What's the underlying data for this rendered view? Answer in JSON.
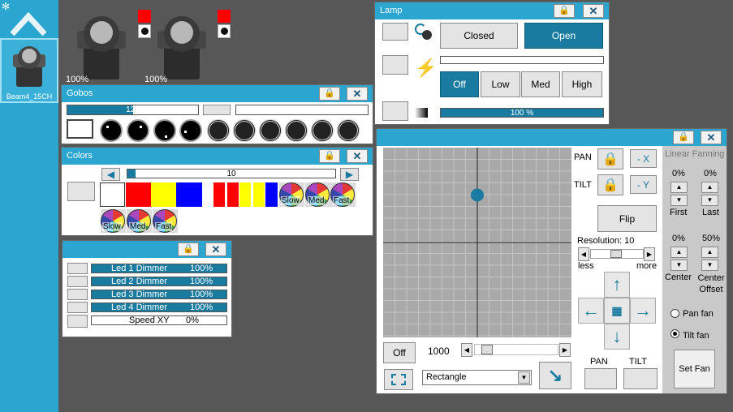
{
  "sidebar": {
    "fixture_label": "Beam4_15CH"
  },
  "fixtures": {
    "fixture1_value": "100%",
    "fixture2_value": "100%"
  },
  "gobos": {
    "title": "Gobos",
    "value": "129"
  },
  "colors": {
    "title": "Colors",
    "value": "10",
    "wheel_labels": [
      "Slow",
      "Med",
      "Fast",
      "Slow",
      "Med",
      "Fast"
    ]
  },
  "leds": {
    "items": [
      {
        "name": "Led 1 Dimmer",
        "value": "100%"
      },
      {
        "name": "Led 2 Dimmer",
        "value": "100%"
      },
      {
        "name": "Led 3 Dimmer",
        "value": "100%"
      },
      {
        "name": "Led 4 Dimmer",
        "value": "100%"
      }
    ],
    "speed_name": "Speed XY",
    "speed_value": "0%"
  },
  "lamp": {
    "title": "Lamp",
    "closed_label": "Closed",
    "open_label": "Open",
    "off_label": "Off",
    "low_label": "Low",
    "med_label": "Med",
    "high_label": "High",
    "dimmer_value": "100 %",
    "dimmer_fraction": 1.0
  },
  "xy": {
    "pan_label": "PAN",
    "tilt_label": "TILT",
    "minus_x_label": "- X",
    "minus_y_label": "- Y",
    "flip_label": "Flip",
    "resolution_label": "Resolution: 10",
    "less_label": "less",
    "more_label": "more",
    "off_label": "Off",
    "speed_value": "1000",
    "shape_value": "Rectangle",
    "pan_bottom_label": "PAN",
    "tilt_bottom_label": "TILT",
    "point_x": 0.5,
    "point_y": 0.25
  },
  "fanning": {
    "title": "Linear Fanning",
    "first_value": "0%",
    "last_value": "0%",
    "first_label": "First",
    "last_label": "Last",
    "center_value": "0%",
    "center_offset_value": "50%",
    "center_label": "Center",
    "center_offset_label": "Center Offset",
    "pan_fan_label": "Pan fan",
    "tilt_fan_label": "Tilt fan",
    "set_fan_label": "Set Fan"
  },
  "colors_swatches": [
    "#ffffff",
    "#ff0000",
    "#ffff00",
    "#0000ff"
  ]
}
